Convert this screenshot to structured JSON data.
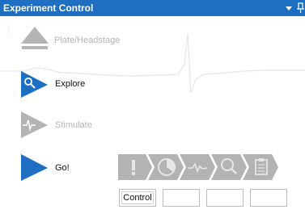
{
  "window": {
    "title": "Experiment Control"
  },
  "steps": [
    {
      "label": "Plate/Headstage",
      "state": "disabled",
      "icon": "eject-icon"
    },
    {
      "label": "Explore",
      "state": "enabled",
      "icon": "explore-magnifier-icon"
    },
    {
      "label": "Stimulate",
      "state": "disabled",
      "icon": "stimulate-icon"
    },
    {
      "label": "Go!",
      "state": "enabled",
      "icon": "play-icon"
    }
  ],
  "pipeline": {
    "stages": [
      "alert-icon",
      "timer-pie-icon",
      "waveform-icon",
      "search-icon",
      "clipboard-icon"
    ]
  },
  "slots": [
    {
      "label": "Control"
    },
    {
      "label": ""
    },
    {
      "label": ""
    },
    {
      "label": ""
    }
  ],
  "colors": {
    "titlebar": "#1e6fc1",
    "accent_blue": "#1e6fc1",
    "disabled_gray": "#b4b4b4",
    "pipeline_gray": "#b3b3b3"
  }
}
